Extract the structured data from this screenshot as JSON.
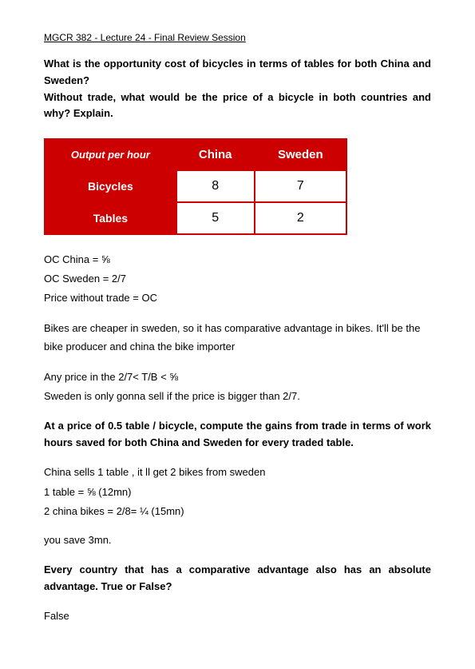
{
  "title": "MGCR 382 - Lecture 24 - Final Review Session",
  "question1": {
    "line1": "What is the   opportunity cost of bicycles      in terms of   tables  for  both  China  and   Sweden?",
    "line2": "Without   trade,  what  would  be    the   price   of    a    bicycle   in  both  countries    and   why?  Explain."
  },
  "table": {
    "header_left": "Output per hour",
    "col1": "China",
    "col2": "Sweden",
    "row1_label": "Bicycles",
    "row1_col1": "8",
    "row1_col2": "7",
    "row2_label": "Tables",
    "row2_col1": "5",
    "row2_col2": "2"
  },
  "analysis1": {
    "line1": "OC China = ⅝",
    "line2": "OC Sweden = 2/7",
    "line3": "Price without trade = OC"
  },
  "analysis2": {
    "text": "Bikes are cheaper in sweden, so it has comparative advantage in bikes. It'll be the bike producer and china the bike importer"
  },
  "analysis3": {
    "line1": "Any price in the 2/7< T/B < ⅝",
    "line2": "Sweden is only gonna sell if the price is bigger than 2/7."
  },
  "question2": {
    "text": "At a price of 0.5 table / bicycle, compute the   gains from  trade  in   terms of  work  hours saved for    both  China and   Sweden  for    every traded table."
  },
  "analysis4": {
    "line1": "China sells 1 table , it ll get 2 bikes from sweden",
    "line2": "1 table = ⅝ (12mn)",
    "line3": "2 china bikes = 2/8= ¼  (15mn)"
  },
  "analysis5": {
    "text": "you save 3mn."
  },
  "question3": {
    "text": "Every  country    that   has   a     comparative  advantage  also  has  an  absolute    advantage.   True  or   False?"
  },
  "answer": {
    "text": "False"
  }
}
